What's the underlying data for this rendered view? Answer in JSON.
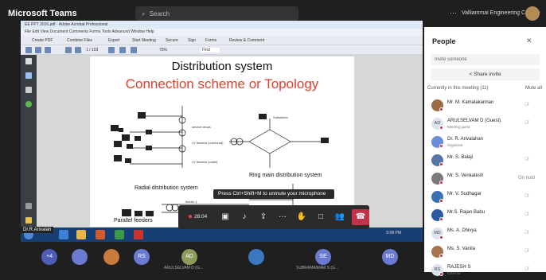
{
  "app": {
    "brand": "Microsoft Teams",
    "search_placeholder": "Search",
    "more": "···",
    "org_name": "Valliammai Engineering College"
  },
  "acrobat": {
    "title": "EE PPT 2016.pdf - Adobe Acrobat Professional",
    "menu": "File  Edit  View  Document  Comments  Forms  Tools  Advanced  Window  Help",
    "tb1": [
      "Create PDF",
      "Combine Files",
      "Export",
      "Start Meeting",
      "Secure",
      "Sign",
      "Forms",
      "Review & Comment"
    ],
    "page_indicator": "1 / 103",
    "zoom": "75%",
    "find": "Find"
  },
  "slide": {
    "title": "Distribution system",
    "subtitle": "Connection scheme or Topology",
    "radial_label": "Radial distribution system",
    "ring_label": "Ring main distribution system",
    "parallel_label": "Parallel feeders",
    "labels": [
      "service drops",
      "LV feeders (overhead)",
      "LV feeders (cable)",
      "Substation",
      "feeder 1",
      "feeder 2"
    ]
  },
  "meeting": {
    "hint": "Press Ctrl+Shift+M to unmute your microphone",
    "timer": "28:04",
    "presenter_chip": "Dr.R.Arivalah",
    "tray_time": "5:08 PM",
    "tray_date": "11-09-2021"
  },
  "strip": {
    "more_count": "+4",
    "tiles": [
      {
        "initials": "",
        "color": "#6a7bd1",
        "name": ""
      },
      {
        "initials": "",
        "color": "#c97a3d",
        "name": ""
      },
      {
        "initials": "RS",
        "color": "#6a7bd1",
        "name": ""
      },
      {
        "initials": "AD",
        "color": "#8a9b5a",
        "name": "ARULSELVAM D (G..."
      },
      {
        "initials": "",
        "color": "#3b78c2",
        "name": ""
      },
      {
        "initials": "SE",
        "color": "#6a7bd1",
        "name": "SUBRAMANIAM S (G..."
      },
      {
        "initials": "MD",
        "color": "#6a7bd1",
        "name": ""
      }
    ]
  },
  "people": {
    "title": "People",
    "invite_placeholder": "Invite someone",
    "share_invite": "Share invite",
    "section": "Currently in this meeting (11)",
    "mute_all": "Mute all",
    "list": [
      {
        "name": "Mr. M. Kamalakannan",
        "sub": "",
        "initials": "",
        "color": "#9b6b45",
        "action": "🎙̸"
      },
      {
        "name": "ARULSELVAM D (Guest)",
        "sub": "Meeting guest",
        "initials": "AD",
        "color": "#dde3ee",
        "action": "🎙̸"
      },
      {
        "name": "Dr. R. Arivalahan",
        "sub": "Organizer",
        "initials": "",
        "color": "#6a8fd8",
        "action": ""
      },
      {
        "name": "Mr. S. Balaji",
        "sub": "",
        "initials": "",
        "color": "#5477a8",
        "action": "🎙̸"
      },
      {
        "name": "Mr. S. Venkatesh",
        "sub": "",
        "initials": "",
        "color": "#7b7b7b",
        "action": "On hold"
      },
      {
        "name": "Mr. V. Sudhagar",
        "sub": "",
        "initials": "",
        "color": "#3a6fb0",
        "action": "🎙̸"
      },
      {
        "name": "Mr.S. Rajan Babu",
        "sub": "",
        "initials": "",
        "color": "#2c5aa0",
        "action": "🎙̸"
      },
      {
        "name": "Ms. A. Dhivya",
        "sub": "",
        "initials": "MD",
        "color": "#dde3ee",
        "action": "🎙̸"
      },
      {
        "name": "Ms. S. Vanila",
        "sub": "",
        "initials": "",
        "color": "#a8744e",
        "action": "🎙̸"
      },
      {
        "name": "RAJESH S",
        "sub": "External",
        "initials": "RS",
        "color": "#dde3ee",
        "action": "🎙̸"
      }
    ]
  }
}
